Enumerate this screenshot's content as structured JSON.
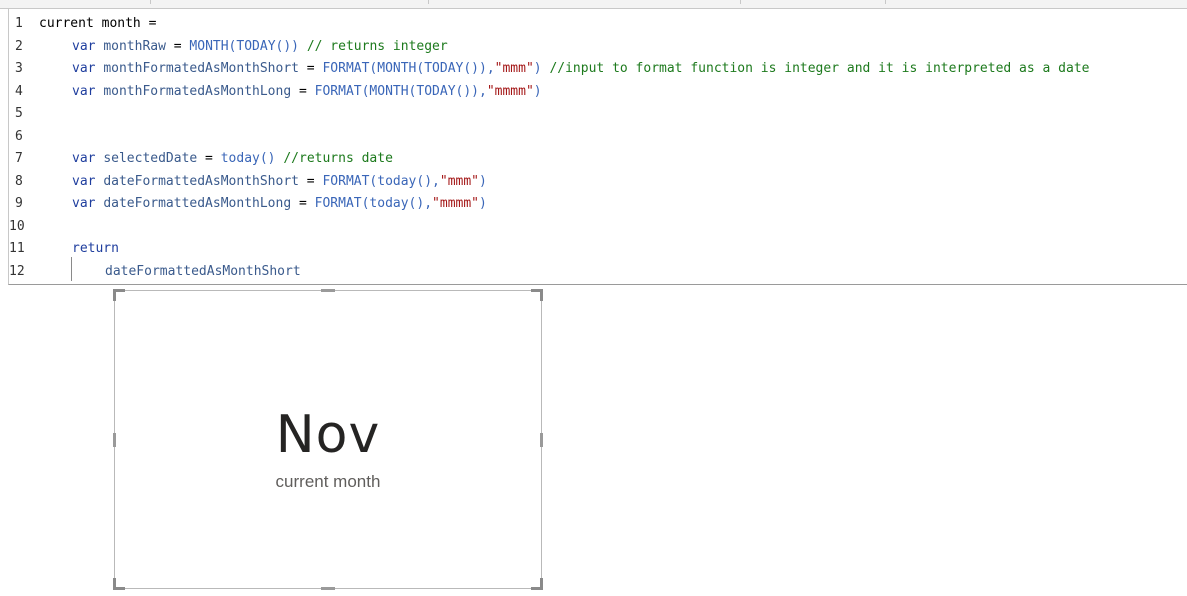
{
  "editor": {
    "line_numbers": [
      "1",
      "2",
      "3",
      "4",
      "5",
      "6",
      "7",
      "8",
      "9",
      "10",
      "11",
      "12"
    ],
    "lines": [
      [
        {
          "t": "plain",
          "v": "current month ="
        }
      ],
      [
        {
          "t": "kw",
          "v": "var"
        },
        {
          "t": "plain",
          "v": " "
        },
        {
          "t": "id",
          "v": "monthRaw"
        },
        {
          "t": "op",
          "v": " = "
        },
        {
          "t": "fn",
          "v": "MONTH(TODAY())"
        },
        {
          "t": "plain",
          "v": " "
        },
        {
          "t": "cm",
          "v": "// returns integer"
        }
      ],
      [
        {
          "t": "kw",
          "v": "var"
        },
        {
          "t": "plain",
          "v": " "
        },
        {
          "t": "id",
          "v": "monthFormatedAsMonthShort"
        },
        {
          "t": "op",
          "v": " = "
        },
        {
          "t": "fn",
          "v": "FORMAT(MONTH(TODAY()),"
        },
        {
          "t": "str",
          "v": "\"mmm\""
        },
        {
          "t": "fn",
          "v": ")"
        },
        {
          "t": "plain",
          "v": " "
        },
        {
          "t": "cm",
          "v": "//input to format function is integer and it is interpreted as a date"
        }
      ],
      [
        {
          "t": "kw",
          "v": "var"
        },
        {
          "t": "plain",
          "v": " "
        },
        {
          "t": "id",
          "v": "monthFormatedAsMonthLong"
        },
        {
          "t": "op",
          "v": " = "
        },
        {
          "t": "fn",
          "v": "FORMAT(MONTH(TODAY()),"
        },
        {
          "t": "str",
          "v": "\"mmmm\""
        },
        {
          "t": "fn",
          "v": ")"
        }
      ],
      [],
      [],
      [
        {
          "t": "kw",
          "v": "var"
        },
        {
          "t": "plain",
          "v": " "
        },
        {
          "t": "id",
          "v": "selectedDate"
        },
        {
          "t": "op",
          "v": " = "
        },
        {
          "t": "fn",
          "v": "today()"
        },
        {
          "t": "plain",
          "v": " "
        },
        {
          "t": "cm",
          "v": "//returns date"
        }
      ],
      [
        {
          "t": "kw",
          "v": "var"
        },
        {
          "t": "plain",
          "v": " "
        },
        {
          "t": "id",
          "v": "dateFormattedAsMonthShort"
        },
        {
          "t": "op",
          "v": " = "
        },
        {
          "t": "fn",
          "v": "FORMAT(today(),"
        },
        {
          "t": "str",
          "v": "\"mmm\""
        },
        {
          "t": "fn",
          "v": ")"
        }
      ],
      [
        {
          "t": "kw",
          "v": "var"
        },
        {
          "t": "plain",
          "v": " "
        },
        {
          "t": "id",
          "v": "dateFormattedAsMonthLong"
        },
        {
          "t": "op",
          "v": " = "
        },
        {
          "t": "fn",
          "v": "FORMAT(today(),"
        },
        {
          "t": "str",
          "v": "\"mmmm\""
        },
        {
          "t": "fn",
          "v": ")"
        }
      ],
      [],
      [
        {
          "t": "kw",
          "v": "return"
        }
      ],
      [
        {
          "t": "id",
          "v": "dateFormattedAsMonthShort"
        }
      ]
    ],
    "indent": [
      0,
      1,
      1,
      1,
      0,
      0,
      1,
      1,
      1,
      0,
      1,
      2
    ],
    "colors": {
      "keyword": "#1f3e9e",
      "identifier": "#3a5a8c",
      "function": "#3a66b8",
      "string": "#a31515",
      "comment": "#1d7a1d"
    }
  },
  "card": {
    "value": "Nov",
    "label": "current month"
  }
}
